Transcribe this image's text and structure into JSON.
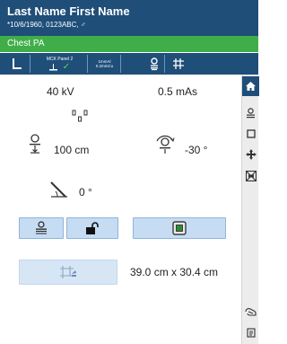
{
  "patient": {
    "name": "Last Name First Name",
    "details": "*10/6/1960, 0123ABC, ♂"
  },
  "exam": {
    "label": "Chest PA"
  },
  "toolbar": {
    "detector_label": "MCK Panel 2",
    "filter_line1": "1mmAl",
    "filter_line2": "0.2mmCu"
  },
  "exposure": {
    "kv": "40 kV",
    "mas": "0.5 mAs"
  },
  "geometry": {
    "sid": "100 cm",
    "tube_angle": "-30 °",
    "detector_angle": "0 °"
  },
  "collimation": {
    "field_size": "39.0 cm x 30.4 cm"
  },
  "icons": {
    "home": "home-icon",
    "patient": "patient-icon",
    "window": "window-icon",
    "move": "move-icon",
    "grid": "grid-icon",
    "hand": "hand-icon",
    "notes": "notes-icon"
  },
  "colors": {
    "header": "#1f4e79",
    "exam_bar": "#3fae49",
    "button": "#c6dcf3",
    "check": "#5ed35e"
  }
}
